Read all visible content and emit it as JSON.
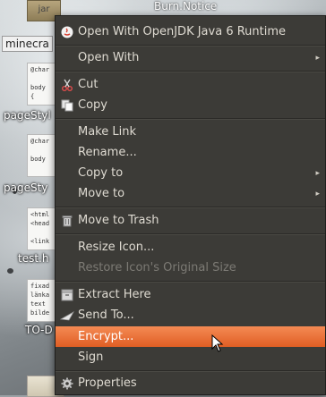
{
  "desktop": {
    "top_folder_label": "jar",
    "top_right_label": "Burn.Notice",
    "selected_icon_label": "minecra",
    "icons": [
      {
        "label": "pageStyl",
        "thumb": "@char\n\nbody\n{"
      },
      {
        "label": "pageSty",
        "thumb": "@char\n\nbody"
      },
      {
        "label": "test.h",
        "thumb": "<html\n<head\n\n<link"
      },
      {
        "label": "TO-D",
        "thumb": "fixad\nlänka\ntext\nbilde"
      }
    ]
  },
  "menu": {
    "items": [
      {
        "label": "Open With OpenJDK Java 6 Runtime",
        "icon": "java-icon"
      },
      {
        "label": "Open With",
        "submenu": true
      },
      {
        "label": "Cut",
        "icon": "scissors-icon"
      },
      {
        "label": "Copy",
        "icon": "copy-icon"
      },
      {
        "label": "Make Link"
      },
      {
        "label": "Rename..."
      },
      {
        "label": "Copy to",
        "submenu": true
      },
      {
        "label": "Move to",
        "submenu": true
      },
      {
        "label": "Move to Trash",
        "icon": "trash-icon"
      },
      {
        "label": "Resize Icon..."
      },
      {
        "label": "Restore Icon's Original Size",
        "disabled": true
      },
      {
        "label": "Extract Here",
        "icon": "archive-icon"
      },
      {
        "label": "Send To...",
        "icon": "send-icon"
      },
      {
        "label": "Encrypt...",
        "highlighted": true
      },
      {
        "label": "Sign"
      },
      {
        "label": "Properties",
        "icon": "gear-icon"
      }
    ],
    "highlight_color": "#f07746",
    "background_color": "#3c3b37"
  }
}
